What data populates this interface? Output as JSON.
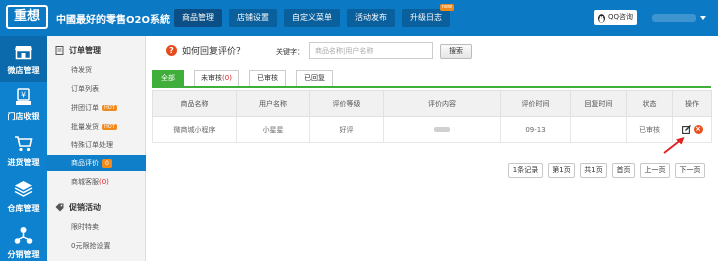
{
  "header": {
    "logo_text": "重想",
    "system_title": "中國最好的零售O2O系統",
    "nav": [
      {
        "label": "商品管理"
      },
      {
        "label": "店铺设置"
      },
      {
        "label": "自定义菜单"
      },
      {
        "label": "活动发布"
      },
      {
        "label": "升级日志",
        "badge": "new"
      }
    ],
    "qq_label": "QQ咨询"
  },
  "iconbar": [
    {
      "label": "微店管理",
      "icon": "store-icon",
      "active": true
    },
    {
      "label": "门店收银",
      "icon": "cash-register-icon",
      "active": false
    },
    {
      "label": "进货管理",
      "icon": "cart-icon",
      "active": false
    },
    {
      "label": "仓库管理",
      "icon": "warehouse-icon",
      "active": false
    },
    {
      "label": "分销管理",
      "icon": "distribution-icon",
      "active": false
    }
  ],
  "submenu": {
    "order_section": "订单管理",
    "items": [
      {
        "label": "待发货"
      },
      {
        "label": "订单列表"
      },
      {
        "label": "拼团订单",
        "hot": "HOT"
      },
      {
        "label": "批量发货",
        "hot": "HOT"
      },
      {
        "label": "特殊订单处理"
      },
      {
        "label": "商品评价",
        "count": "0"
      },
      {
        "label": "商城客服",
        "count_text": "(0)"
      }
    ],
    "promo_section": "促销活动",
    "promo_items": [
      {
        "label": "限时特卖"
      },
      {
        "label": "0元限抢设置"
      }
    ]
  },
  "main": {
    "question": "如何回复评价？",
    "keyword_label": "关键字：",
    "keyword_placeholder": "商品名称|用户名称",
    "search_label": "搜索",
    "tabs": [
      {
        "label": "全部"
      },
      {
        "label": "未审核",
        "count": "(0)"
      },
      {
        "label": "已审核"
      },
      {
        "label": "已回复"
      }
    ],
    "columns": [
      "商品名称",
      "用户名称",
      "评价等级",
      "评价内容",
      "评价时间",
      "回复时间",
      "状态",
      "操作"
    ],
    "rows": [
      {
        "product": "微商城小程序",
        "user": "小星星",
        "rating": "好评",
        "content": "",
        "time": "09-13",
        "reply_time": "",
        "status": "已审核"
      }
    ],
    "pager": {
      "records": "1条记录",
      "page": "第1页",
      "total": "共1页",
      "first": "首页",
      "prev": "上一页",
      "next": "下一页"
    }
  },
  "colors": {
    "header_blue": "#0b79c4",
    "sidebar_blue": "#0e82cf",
    "tab_green": "#3fae3a",
    "accent_orange": "#f08a1c",
    "arrow_red": "#e02020"
  }
}
